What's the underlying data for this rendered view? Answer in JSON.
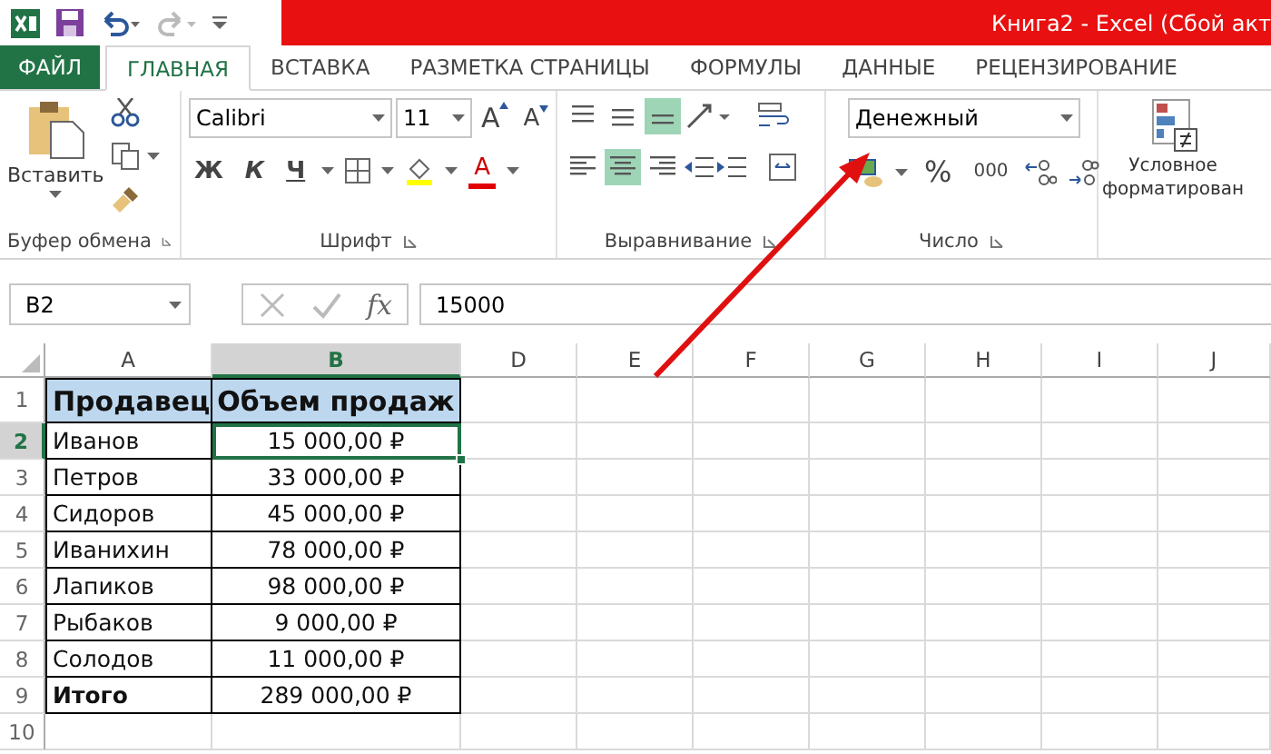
{
  "title_bar": {
    "title": "Книга2 -  Excel (Сбой акт"
  },
  "tabs": [
    {
      "label": "ФАЙЛ",
      "kind": "file",
      "selected": false
    },
    {
      "label": "ГЛАВНАЯ",
      "kind": "tab",
      "selected": true
    },
    {
      "label": "ВСТАВКА",
      "kind": "tab",
      "selected": false
    },
    {
      "label": "РАЗМЕТКА СТРАНИЦЫ",
      "kind": "tab",
      "selected": false
    },
    {
      "label": "ФОРМУЛЫ",
      "kind": "tab",
      "selected": false
    },
    {
      "label": "ДАННЫЕ",
      "kind": "tab",
      "selected": false
    },
    {
      "label": "РЕЦЕНЗИРОВАНИЕ",
      "kind": "tab",
      "selected": false
    }
  ],
  "ribbon": {
    "clipboard": {
      "label": "Буфер обмена",
      "paste": "Вставить"
    },
    "font": {
      "label": "Шрифт",
      "name": "Calibri",
      "size": "11",
      "grow": "A",
      "shrink": "A",
      "bold": "Ж",
      "italic": "К",
      "underline": "Ч",
      "color_letter": "A"
    },
    "alignment": {
      "label": "Выравнивание",
      "vertical_buttons": [
        {
          "selected": false
        },
        {
          "selected": false
        },
        {
          "selected": true
        }
      ],
      "horizontal_buttons": [
        {
          "selected": false
        },
        {
          "selected": true
        },
        {
          "selected": false
        }
      ]
    },
    "number": {
      "label": "Число",
      "format": "Денежный",
      "percent": "%",
      "thousands": "000"
    },
    "styles": {
      "conditional_lines": [
        "Условное",
        "форматирован"
      ]
    }
  },
  "formula_bar": {
    "name_box": "B2",
    "fx": "fx",
    "value": "15000"
  },
  "sheet": {
    "columns": [
      {
        "label": "A",
        "selected": false
      },
      {
        "label": "B",
        "selected": true
      },
      {
        "label": "D",
        "selected": false
      },
      {
        "label": "E",
        "selected": false
      },
      {
        "label": "F",
        "selected": false
      },
      {
        "label": "G",
        "selected": false
      },
      {
        "label": "H",
        "selected": false
      },
      {
        "label": "I",
        "selected": false
      },
      {
        "label": "J",
        "selected": false
      }
    ],
    "rows": [
      {
        "number": "1",
        "kind": "header",
        "selected": false,
        "cells": [
          {
            "text": "Продавец",
            "selected": false
          },
          {
            "text": "Объем продаж",
            "selected": false
          }
        ]
      },
      {
        "number": "2",
        "kind": "data",
        "selected": true,
        "cells": [
          {
            "text": "Иванов",
            "selected": false
          },
          {
            "text": "15 000,00 ₽",
            "selected": true
          }
        ]
      },
      {
        "number": "3",
        "kind": "data",
        "selected": false,
        "cells": [
          {
            "text": "Петров",
            "selected": false
          },
          {
            "text": "33 000,00 ₽",
            "selected": false
          }
        ]
      },
      {
        "number": "4",
        "kind": "data",
        "selected": false,
        "cells": [
          {
            "text": "Сидоров",
            "selected": false
          },
          {
            "text": "45 000,00 ₽",
            "selected": false
          }
        ]
      },
      {
        "number": "5",
        "kind": "data",
        "selected": false,
        "cells": [
          {
            "text": "Иванихин",
            "selected": false
          },
          {
            "text": "78 000,00 ₽",
            "selected": false
          }
        ]
      },
      {
        "number": "6",
        "kind": "data",
        "selected": false,
        "cells": [
          {
            "text": "Лапиков",
            "selected": false
          },
          {
            "text": "98 000,00 ₽",
            "selected": false
          }
        ]
      },
      {
        "number": "7",
        "kind": "data",
        "selected": false,
        "cells": [
          {
            "text": "Рыбаков",
            "selected": false
          },
          {
            "text": "9 000,00 ₽",
            "selected": false
          }
        ]
      },
      {
        "number": "8",
        "kind": "data",
        "selected": false,
        "cells": [
          {
            "text": "Солодов",
            "selected": false
          },
          {
            "text": "11 000,00 ₽",
            "selected": false
          }
        ]
      },
      {
        "number": "9",
        "kind": "total",
        "selected": false,
        "cells": [
          {
            "text": "Итого",
            "selected": false
          },
          {
            "text": "289 000,00 ₽",
            "selected": false
          }
        ]
      },
      {
        "number": "10",
        "kind": "blank",
        "selected": false,
        "cells": []
      }
    ]
  }
}
